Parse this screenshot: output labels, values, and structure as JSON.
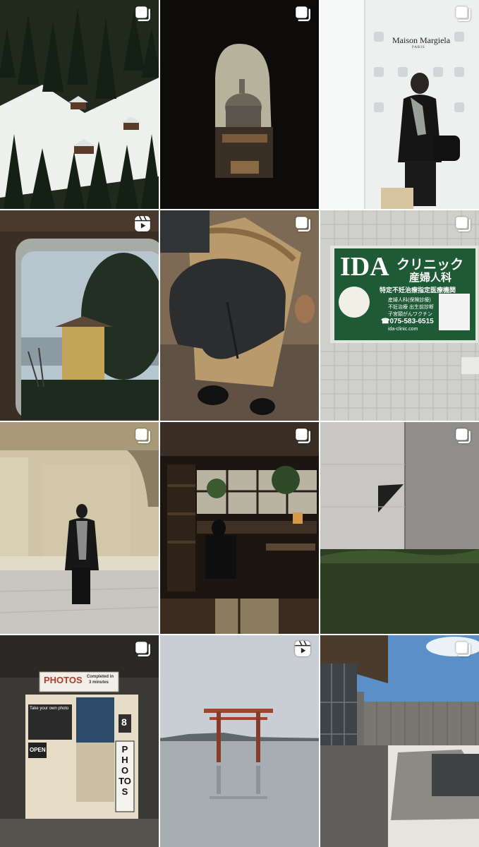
{
  "grid": {
    "columns": 3,
    "rows": 4,
    "posts": [
      {
        "type": "carousel",
        "badge_icon": "carousel-icon",
        "scene": "snowy-forest-chalets"
      },
      {
        "type": "carousel",
        "badge_icon": "carousel-icon",
        "scene": "keyhole-dome-view"
      },
      {
        "type": "carousel",
        "badge_icon": "carousel-icon",
        "scene": "woman-maison-margiela-store",
        "sign_brand": "Maison Margiela",
        "sign_sub": "PARIS"
      },
      {
        "type": "reel",
        "badge_icon": "reels-icon",
        "scene": "train-window-lake-villa"
      },
      {
        "type": "carousel",
        "badge_icon": "carousel-icon",
        "scene": "black-saddle-bag"
      },
      {
        "type": "carousel",
        "badge_icon": "carousel-icon",
        "scene": "clinic-billboard",
        "sign_main": "IDA",
        "sign_kana": "クリニック",
        "sign_dept": "産婦人科",
        "sign_tagline": "特定不妊治療指定医療機関",
        "sign_list": [
          "産婦人科(保険診療)",
          "不妊治療 出生前診断",
          "子宮頸がんワクチン"
        ],
        "sign_phone": "☎075-583-6515",
        "sign_url": "ida-clinic.com"
      },
      {
        "type": "carousel",
        "badge_icon": "carousel-icon",
        "scene": "woman-stone-arcade"
      },
      {
        "type": "carousel",
        "badge_icon": "carousel-icon",
        "scene": "dim-study-room"
      },
      {
        "type": "carousel",
        "badge_icon": "carousel-icon",
        "scene": "concrete-courtyard-grass"
      },
      {
        "type": "carousel",
        "badge_icon": "carousel-icon",
        "scene": "photo-booth",
        "booth_sign": "PHOTOS",
        "booth_sign_sub_1": "Completed in",
        "booth_sign_sub_2": "3 minutes",
        "booth_side": "PHOTOS",
        "booth_number": "8",
        "booth_panel": "Take your own photo",
        "booth_open": "OPEN"
      },
      {
        "type": "reel",
        "badge_icon": "reels-icon",
        "scene": "torii-gate-in-lake"
      },
      {
        "type": "carousel",
        "badge_icon": "carousel-icon",
        "scene": "modern-building-stone-garden"
      }
    ]
  },
  "colors": {
    "badge": "#ffffff",
    "clinic_green": "#1f5a36",
    "booth_beige": "#e7dcc6"
  }
}
